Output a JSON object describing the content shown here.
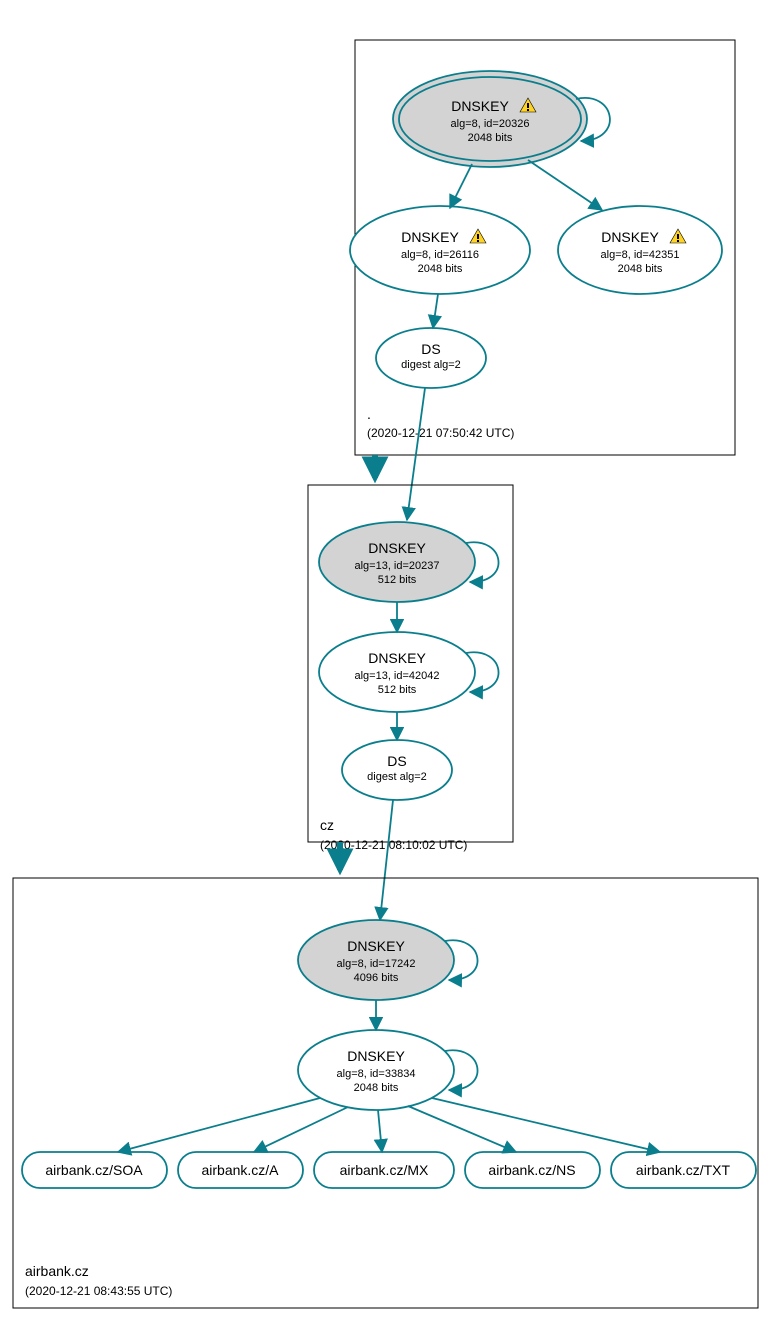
{
  "colors": {
    "accent": "#0a7e8c",
    "fill_grey": "#d3d3d3"
  },
  "zones": {
    "root": {
      "name": ".",
      "timestamp": "(2020-12-21 07:50:42 UTC)"
    },
    "cz": {
      "name": "cz",
      "timestamp": "(2020-12-21 08:10:02 UTC)"
    },
    "airbank": {
      "name": "airbank.cz",
      "timestamp": "(2020-12-21 08:43:55 UTC)"
    }
  },
  "nodes": {
    "root_ksk": {
      "title": "DNSKEY",
      "line2": "alg=8, id=20326",
      "line3": "2048 bits",
      "warn": true
    },
    "root_zsk1": {
      "title": "DNSKEY",
      "line2": "alg=8, id=26116",
      "line3": "2048 bits",
      "warn": true
    },
    "root_zsk2": {
      "title": "DNSKEY",
      "line2": "alg=8, id=42351",
      "line3": "2048 bits",
      "warn": true
    },
    "root_ds": {
      "title": "DS",
      "line2": "digest alg=2"
    },
    "cz_ksk": {
      "title": "DNSKEY",
      "line2": "alg=13, id=20237",
      "line3": "512 bits"
    },
    "cz_zsk": {
      "title": "DNSKEY",
      "line2": "alg=13, id=42042",
      "line3": "512 bits"
    },
    "cz_ds": {
      "title": "DS",
      "line2": "digest alg=2"
    },
    "ab_ksk": {
      "title": "DNSKEY",
      "line2": "alg=8, id=17242",
      "line3": "4096 bits"
    },
    "ab_zsk": {
      "title": "DNSKEY",
      "line2": "alg=8, id=33834",
      "line3": "2048 bits"
    }
  },
  "records": {
    "soa": "airbank.cz/SOA",
    "a": "airbank.cz/A",
    "mx": "airbank.cz/MX",
    "ns": "airbank.cz/NS",
    "txt": "airbank.cz/TXT"
  }
}
